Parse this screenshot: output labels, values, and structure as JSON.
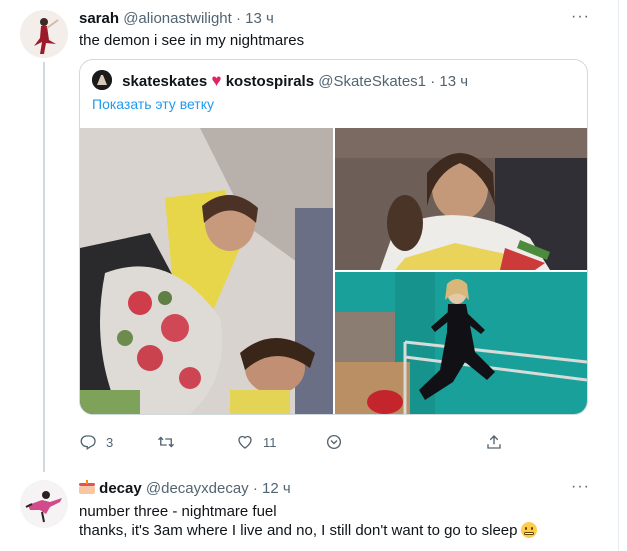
{
  "tweet1": {
    "display_name": "sarah",
    "handle": "@alionastwilight",
    "separator": "·",
    "time": "13 ч",
    "more": "···",
    "text": "the demon i see in my nightmares",
    "quote": {
      "display_name_part1": "skateskates",
      "heart": "♥",
      "display_name_part2": "kostospirals",
      "handle": "@SkateSkates1",
      "separator": "·",
      "time": "13 ч",
      "show_thread": "Показать эту ветку"
    },
    "actions": {
      "reply_count": "3",
      "like_count": "11"
    }
  },
  "tweet2": {
    "display_name": "decay",
    "handle": "@decayxdecay",
    "separator": "·",
    "time": "12 ч",
    "more": "···",
    "line1": "number three - nightmare fuel",
    "line2": "thanks, it's 3am where I live and no, I still don't want to go to sleep"
  },
  "colors": {
    "link": "#1d9bf0",
    "muted": "#536471",
    "heart": "#e0245e",
    "border": "#cfd9de"
  },
  "icons": [
    "reply-icon",
    "retweet-icon",
    "like-icon",
    "bookmark-icon",
    "share-icon",
    "more-icon",
    "cake-emoji",
    "grimace-emoji"
  ]
}
